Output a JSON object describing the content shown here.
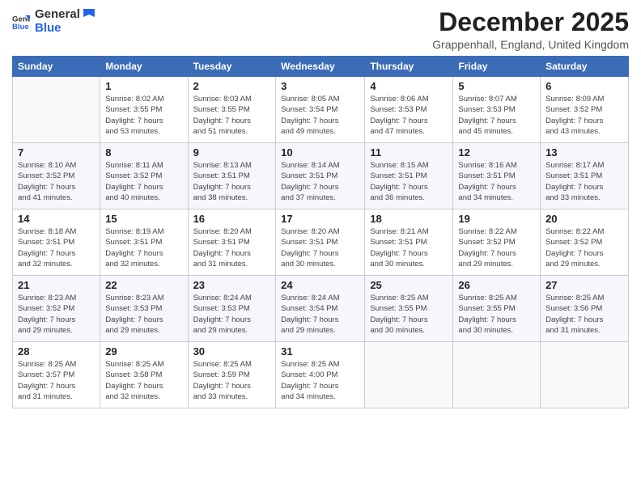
{
  "header": {
    "logo_general": "General",
    "logo_blue": "Blue",
    "main_title": "December 2025",
    "subtitle": "Grappenhall, England, United Kingdom"
  },
  "calendar": {
    "days_of_week": [
      "Sunday",
      "Monday",
      "Tuesday",
      "Wednesday",
      "Thursday",
      "Friday",
      "Saturday"
    ],
    "weeks": [
      [
        {
          "day": "",
          "info": ""
        },
        {
          "day": "1",
          "info": "Sunrise: 8:02 AM\nSunset: 3:55 PM\nDaylight: 7 hours\nand 53 minutes."
        },
        {
          "day": "2",
          "info": "Sunrise: 8:03 AM\nSunset: 3:55 PM\nDaylight: 7 hours\nand 51 minutes."
        },
        {
          "day": "3",
          "info": "Sunrise: 8:05 AM\nSunset: 3:54 PM\nDaylight: 7 hours\nand 49 minutes."
        },
        {
          "day": "4",
          "info": "Sunrise: 8:06 AM\nSunset: 3:53 PM\nDaylight: 7 hours\nand 47 minutes."
        },
        {
          "day": "5",
          "info": "Sunrise: 8:07 AM\nSunset: 3:53 PM\nDaylight: 7 hours\nand 45 minutes."
        },
        {
          "day": "6",
          "info": "Sunrise: 8:09 AM\nSunset: 3:52 PM\nDaylight: 7 hours\nand 43 minutes."
        }
      ],
      [
        {
          "day": "7",
          "info": "Sunrise: 8:10 AM\nSunset: 3:52 PM\nDaylight: 7 hours\nand 41 minutes."
        },
        {
          "day": "8",
          "info": "Sunrise: 8:11 AM\nSunset: 3:52 PM\nDaylight: 7 hours\nand 40 minutes."
        },
        {
          "day": "9",
          "info": "Sunrise: 8:13 AM\nSunset: 3:51 PM\nDaylight: 7 hours\nand 38 minutes."
        },
        {
          "day": "10",
          "info": "Sunrise: 8:14 AM\nSunset: 3:51 PM\nDaylight: 7 hours\nand 37 minutes."
        },
        {
          "day": "11",
          "info": "Sunrise: 8:15 AM\nSunset: 3:51 PM\nDaylight: 7 hours\nand 36 minutes."
        },
        {
          "day": "12",
          "info": "Sunrise: 8:16 AM\nSunset: 3:51 PM\nDaylight: 7 hours\nand 34 minutes."
        },
        {
          "day": "13",
          "info": "Sunrise: 8:17 AM\nSunset: 3:51 PM\nDaylight: 7 hours\nand 33 minutes."
        }
      ],
      [
        {
          "day": "14",
          "info": "Sunrise: 8:18 AM\nSunset: 3:51 PM\nDaylight: 7 hours\nand 32 minutes."
        },
        {
          "day": "15",
          "info": "Sunrise: 8:19 AM\nSunset: 3:51 PM\nDaylight: 7 hours\nand 32 minutes."
        },
        {
          "day": "16",
          "info": "Sunrise: 8:20 AM\nSunset: 3:51 PM\nDaylight: 7 hours\nand 31 minutes."
        },
        {
          "day": "17",
          "info": "Sunrise: 8:20 AM\nSunset: 3:51 PM\nDaylight: 7 hours\nand 30 minutes."
        },
        {
          "day": "18",
          "info": "Sunrise: 8:21 AM\nSunset: 3:51 PM\nDaylight: 7 hours\nand 30 minutes."
        },
        {
          "day": "19",
          "info": "Sunrise: 8:22 AM\nSunset: 3:52 PM\nDaylight: 7 hours\nand 29 minutes."
        },
        {
          "day": "20",
          "info": "Sunrise: 8:22 AM\nSunset: 3:52 PM\nDaylight: 7 hours\nand 29 minutes."
        }
      ],
      [
        {
          "day": "21",
          "info": "Sunrise: 8:23 AM\nSunset: 3:52 PM\nDaylight: 7 hours\nand 29 minutes."
        },
        {
          "day": "22",
          "info": "Sunrise: 8:23 AM\nSunset: 3:53 PM\nDaylight: 7 hours\nand 29 minutes."
        },
        {
          "day": "23",
          "info": "Sunrise: 8:24 AM\nSunset: 3:53 PM\nDaylight: 7 hours\nand 29 minutes."
        },
        {
          "day": "24",
          "info": "Sunrise: 8:24 AM\nSunset: 3:54 PM\nDaylight: 7 hours\nand 29 minutes."
        },
        {
          "day": "25",
          "info": "Sunrise: 8:25 AM\nSunset: 3:55 PM\nDaylight: 7 hours\nand 30 minutes."
        },
        {
          "day": "26",
          "info": "Sunrise: 8:25 AM\nSunset: 3:55 PM\nDaylight: 7 hours\nand 30 minutes."
        },
        {
          "day": "27",
          "info": "Sunrise: 8:25 AM\nSunset: 3:56 PM\nDaylight: 7 hours\nand 31 minutes."
        }
      ],
      [
        {
          "day": "28",
          "info": "Sunrise: 8:25 AM\nSunset: 3:57 PM\nDaylight: 7 hours\nand 31 minutes."
        },
        {
          "day": "29",
          "info": "Sunrise: 8:25 AM\nSunset: 3:58 PM\nDaylight: 7 hours\nand 32 minutes."
        },
        {
          "day": "30",
          "info": "Sunrise: 8:25 AM\nSunset: 3:59 PM\nDaylight: 7 hours\nand 33 minutes."
        },
        {
          "day": "31",
          "info": "Sunrise: 8:25 AM\nSunset: 4:00 PM\nDaylight: 7 hours\nand 34 minutes."
        },
        {
          "day": "",
          "info": ""
        },
        {
          "day": "",
          "info": ""
        },
        {
          "day": "",
          "info": ""
        }
      ]
    ]
  }
}
